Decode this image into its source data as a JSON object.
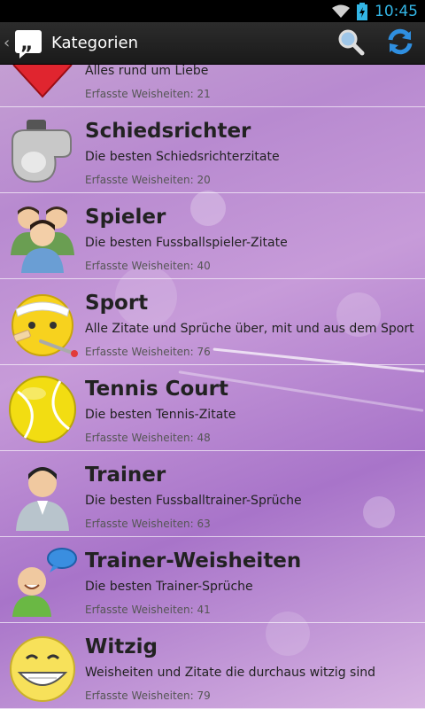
{
  "status": {
    "time": "10:45"
  },
  "actionbar": {
    "title": "Kategorien"
  },
  "categories": [
    {
      "title": "",
      "desc": "Alles rund um Liebe",
      "count": "Erfasste Weisheiten: 21",
      "icon": "heart-icon"
    },
    {
      "title": "Schiedsrichter",
      "desc": "Die besten Schiedsrichterzitate",
      "count": "Erfasste Weisheiten: 20",
      "icon": "whistle-icon"
    },
    {
      "title": "Spieler",
      "desc": "Die besten Fussballspieler-Zitate",
      "count": "Erfasste Weisheiten: 40",
      "icon": "players-icon"
    },
    {
      "title": "Sport",
      "desc": "Alle Zitate und Sprüche über, mit und aus dem Sport",
      "count": "Erfasste Weisheiten: 76",
      "icon": "sick-smiley-icon"
    },
    {
      "title": "Tennis Court",
      "desc": "Die besten Tennis-Zitate",
      "count": "Erfasste Weisheiten: 48",
      "icon": "tennis-ball-icon"
    },
    {
      "title": "Trainer",
      "desc": "Die besten Fussballtrainer-Sprüche",
      "count": "Erfasste Weisheiten: 63",
      "icon": "trainer-icon"
    },
    {
      "title": "Trainer-Weisheiten",
      "desc": "Die besten Trainer-Sprüche",
      "count": "Erfasste Weisheiten: 41",
      "icon": "speaking-person-icon"
    },
    {
      "title": "Witzig",
      "desc": "Weisheiten und Zitate die durchaus witzig sind",
      "count": "Erfasste Weisheiten: 79",
      "icon": "grinning-smiley-icon"
    }
  ]
}
